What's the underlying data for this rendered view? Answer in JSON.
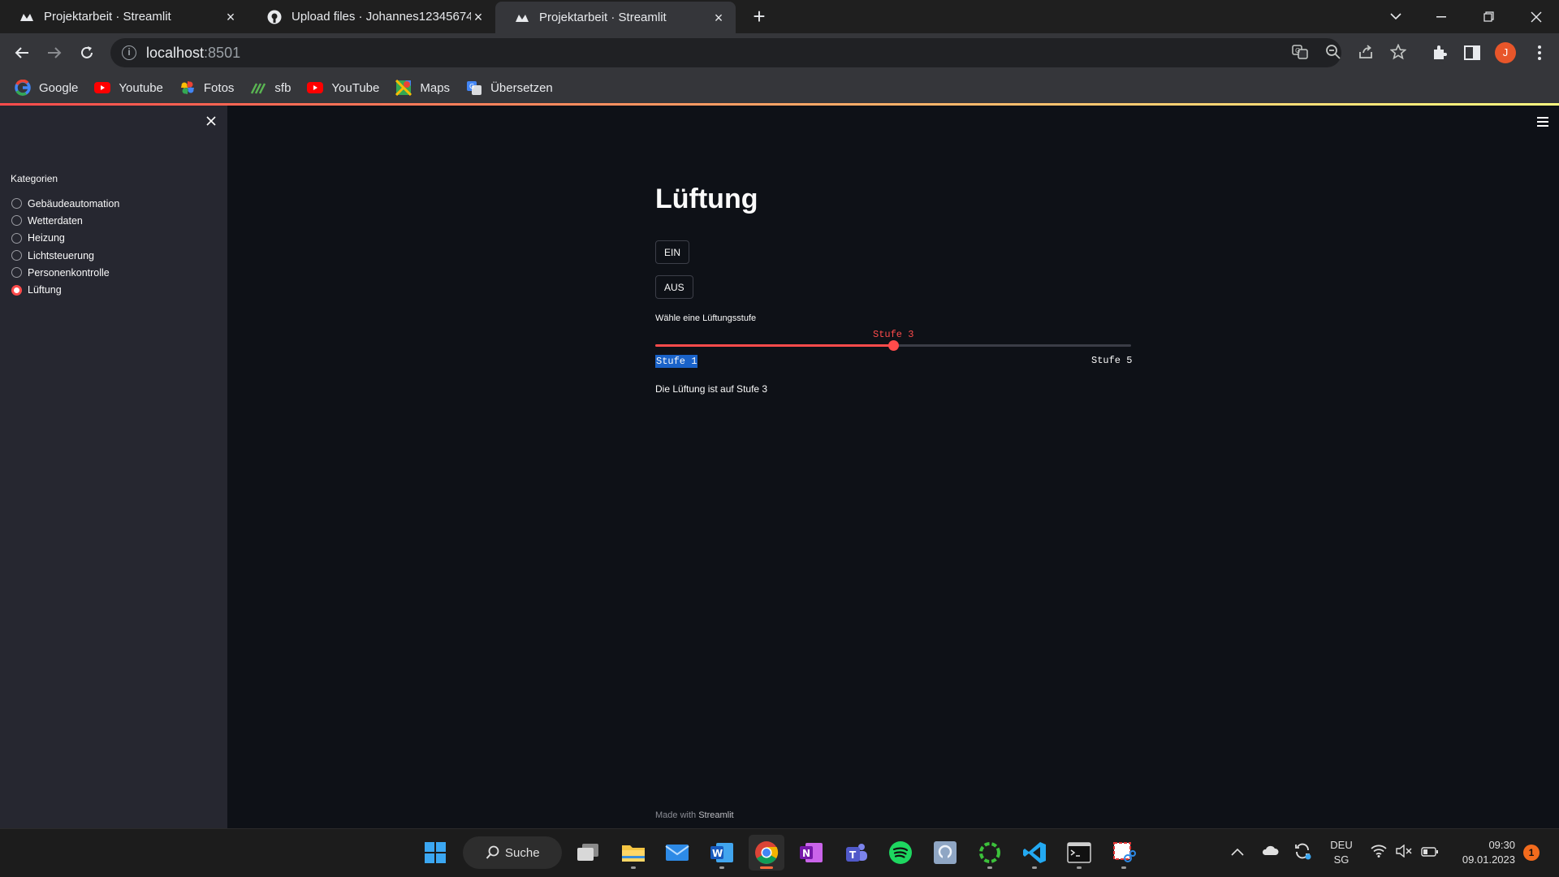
{
  "browser": {
    "tabs": [
      {
        "title": "Projektarbeit · Streamlit",
        "active": false
      },
      {
        "title": "Upload files · Johannes12345674",
        "active": false
      },
      {
        "title": "Projektarbeit · Streamlit",
        "active": true
      }
    ],
    "url_host": "localhost",
    "url_port": ":8501",
    "profile_initial": "J",
    "bookmarks": [
      {
        "label": "Google",
        "icon": "google-icon"
      },
      {
        "label": "Youtube",
        "icon": "youtube-icon"
      },
      {
        "label": "Fotos",
        "icon": "photos-icon"
      },
      {
        "label": "sfb",
        "icon": "sfb-icon"
      },
      {
        "label": "YouTube",
        "icon": "youtube-icon"
      },
      {
        "label": "Maps",
        "icon": "maps-icon"
      },
      {
        "label": "Übersetzen",
        "icon": "translate-icon"
      }
    ]
  },
  "sidebar": {
    "section_label": "Kategorien",
    "options": [
      {
        "label": "Gebäudeautomation",
        "selected": false
      },
      {
        "label": "Wetterdaten",
        "selected": false
      },
      {
        "label": "Heizung",
        "selected": false
      },
      {
        "label": "Lichtsteuerung",
        "selected": false
      },
      {
        "label": "Personenkontrolle",
        "selected": false
      },
      {
        "label": "Lüftung",
        "selected": true
      }
    ]
  },
  "main": {
    "title": "Lüftung",
    "button_on": "EIN",
    "button_off": "AUS",
    "slider": {
      "label": "Wähle eine Lüftungsstufe",
      "min_label": "Stufe 1",
      "max_label": "Stufe 5",
      "value_label": "Stufe 3",
      "min": 1,
      "max": 5,
      "value": 3
    },
    "status": "Die Lüftung ist auf Stufe 3",
    "footer_prefix": "Made with",
    "footer_brand": "Streamlit"
  },
  "taskbar": {
    "search_label": "Suche",
    "language": "DEU",
    "layout": "SG",
    "time": "09:30",
    "date": "09.01.2023",
    "notification_count": "1"
  },
  "colors": {
    "accent": "#ff4b4b",
    "sidebar_bg": "#262730",
    "main_bg": "#0e1117"
  }
}
